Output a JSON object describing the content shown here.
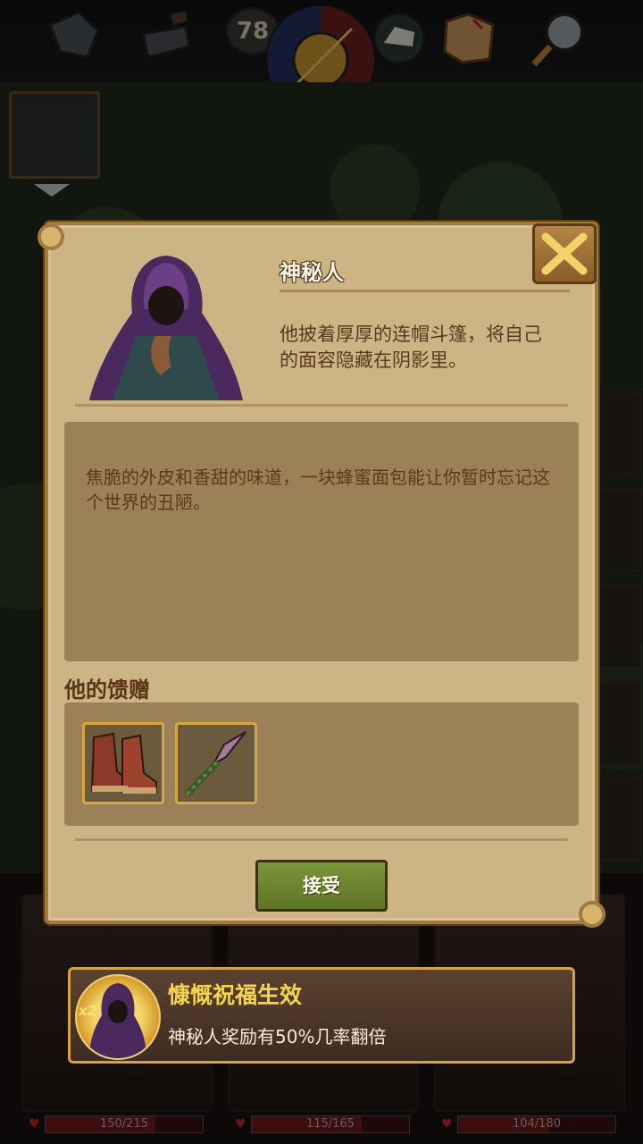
{
  "hud": {
    "day_count": "78"
  },
  "dialog": {
    "npc_name": "神秘人",
    "npc_description": "他披着厚厚的连帽斗篷，将自己的面容隐藏在阴影里。",
    "story_text": "焦脆的外皮和香甜的味道，一块蜂蜜面包能让你暂时忘记这个世界的丑陋。",
    "gifts_title": "他的馈赠",
    "gifts": [
      {
        "name": "boots-icon"
      },
      {
        "name": "spear-icon"
      }
    ],
    "accept_label": "接受"
  },
  "blessing": {
    "multiplier": "x2",
    "title": "慷慨祝福生效",
    "description": "神秘人奖励有50%几率翻倍"
  },
  "heroes": [
    {
      "hp_text": "150/215",
      "hp_fraction": 0.698
    },
    {
      "hp_text": "115/165",
      "hp_fraction": 0.697
    },
    {
      "hp_text": "104/180",
      "hp_fraction": 0.578
    }
  ],
  "colors": {
    "accent_gold": "#d4a24b",
    "accept_green": "#6a8530",
    "parchment": "#cdb485",
    "blessing_title": "#f6d54c"
  }
}
